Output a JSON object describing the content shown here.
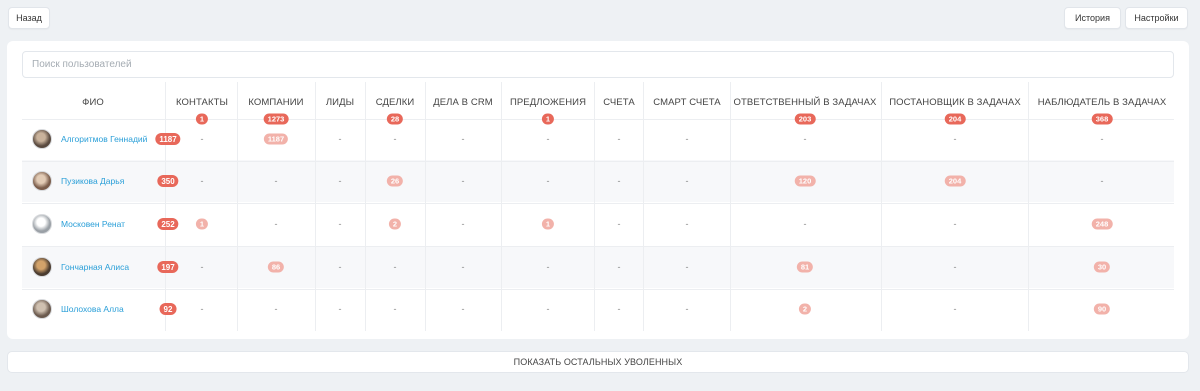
{
  "toolbar": {
    "back_label": "Назад",
    "history_label": "История",
    "settings_label": "Настройки"
  },
  "search": {
    "placeholder": "Поиск пользователей"
  },
  "columns": [
    {
      "label": "ФИО"
    },
    {
      "label": "КОНТАКТЫ",
      "total": "1"
    },
    {
      "label": "КОМПАНИИ",
      "total": "1273"
    },
    {
      "label": "ЛИДЫ"
    },
    {
      "label": "СДЕЛКИ",
      "total": "28"
    },
    {
      "label": "ДЕЛА В CRM"
    },
    {
      "label": "ПРЕДЛОЖЕНИЯ",
      "total": "1"
    },
    {
      "label": "СЧЕТА"
    },
    {
      "label": "СМАРТ СЧЕТА"
    },
    {
      "label": "ОТВЕТСТВЕННЫЙ В ЗАДАЧАХ",
      "total": "203"
    },
    {
      "label": "ПОСТАНОВЩИК В ЗАДАЧАХ",
      "total": "204"
    },
    {
      "label": "НАБЛЮДАТЕЛЬ В ЗАДАЧАХ",
      "total": "368"
    }
  ],
  "rows": [
    {
      "name": "Алгоритмов Геннадий",
      "total": "1187",
      "cells": [
        "-",
        "1187",
        "-",
        "-",
        "-",
        "-",
        "-",
        "-",
        "-",
        "-",
        "-"
      ]
    },
    {
      "name": "Пузикова Дарья",
      "total": "350",
      "cells": [
        "-",
        "-",
        "-",
        "26",
        "-",
        "-",
        "-",
        "-",
        "120",
        "204",
        "-"
      ]
    },
    {
      "name": "Московен Ренат",
      "total": "252",
      "cells": [
        "1",
        "-",
        "-",
        "2",
        "-",
        "1",
        "-",
        "-",
        "-",
        "-",
        "248"
      ]
    },
    {
      "name": "Гончарная Алиса",
      "total": "197",
      "cells": [
        "-",
        "86",
        "-",
        "-",
        "-",
        "-",
        "-",
        "-",
        "81",
        "-",
        "30"
      ]
    },
    {
      "name": "Шолохова Алла",
      "total": "92",
      "cells": [
        "-",
        "-",
        "-",
        "-",
        "-",
        "-",
        "-",
        "-",
        "2",
        "-",
        "90"
      ]
    }
  ],
  "footer": {
    "show_more_label": "ПОКАЗАТЬ ОСТАЛЬНЫХ УВОЛЕННЫХ"
  },
  "colors": {
    "badge_strong": "#e8685a",
    "badge_light": "#f2b2aa",
    "link": "#2a9fd8"
  }
}
